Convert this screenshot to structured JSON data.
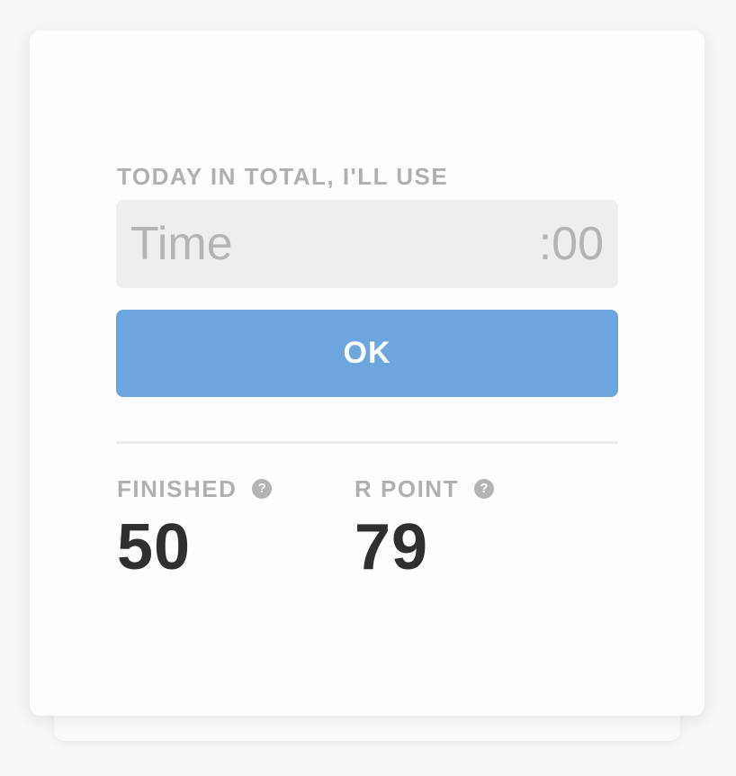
{
  "prompt": {
    "label": "TODAY IN TOTAL, I'LL USE"
  },
  "time_input": {
    "placeholder": "Time",
    "value": "",
    "suffix": ":00"
  },
  "actions": {
    "ok_label": "OK"
  },
  "stats": {
    "finished": {
      "label": "FINISHED",
      "value": "50",
      "help_icon": "question-mark-icon",
      "help_glyph": "?"
    },
    "r_point": {
      "label": "R POINT",
      "value": "79",
      "help_icon": "question-mark-icon",
      "help_glyph": "?"
    }
  },
  "colors": {
    "accent": "#6da5de",
    "label": "#b0b0b0",
    "value": "#2f2f2f",
    "field_bg": "#eeeeee"
  }
}
